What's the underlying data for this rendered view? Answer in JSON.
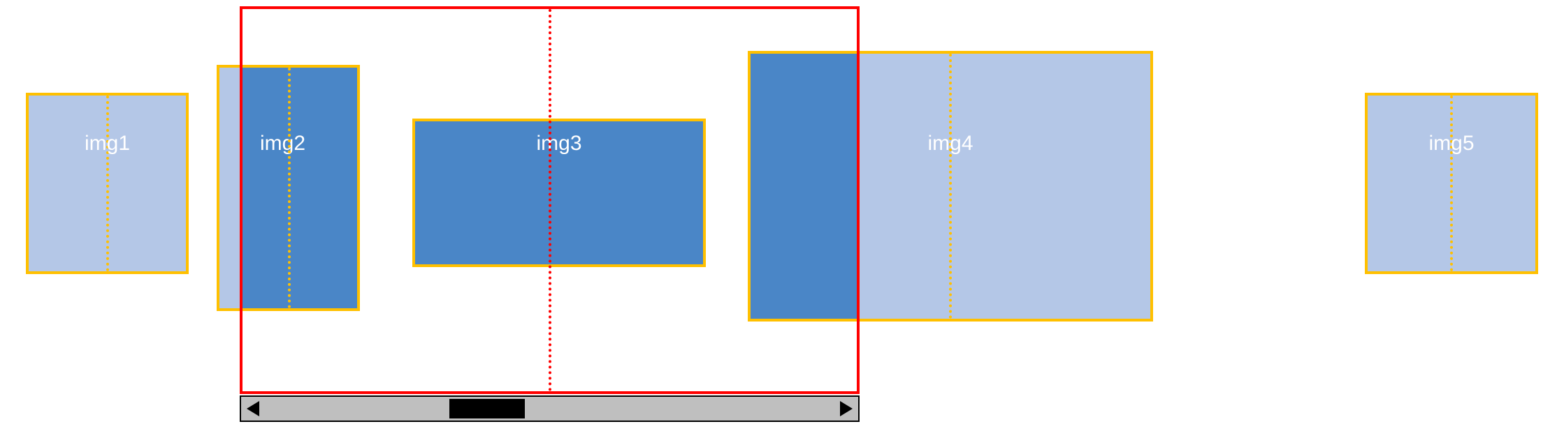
{
  "colors": {
    "light_blue_fill": "#b4c7e7",
    "dark_blue_fill": "#4a86c7",
    "gold_border": "#ffc000",
    "red": "#ff0000",
    "scroll_bg": "#bfbfbf",
    "black": "#000000",
    "label": "#ffffff"
  },
  "images": {
    "img1": {
      "label": "img1"
    },
    "img2": {
      "label": "img2"
    },
    "img3": {
      "label": "img3"
    },
    "img4": {
      "label": "img4"
    },
    "img5": {
      "label": "img5"
    }
  }
}
